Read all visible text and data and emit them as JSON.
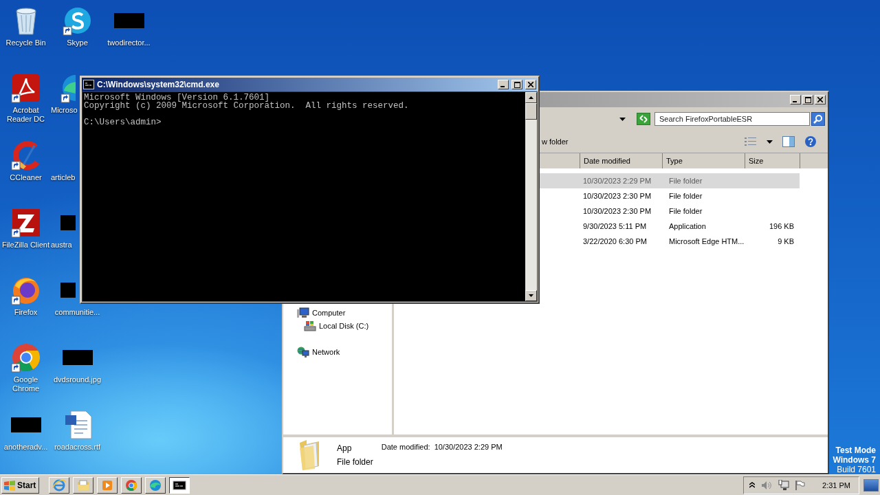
{
  "desktop_icons": [
    {
      "label": "Recycle Bin",
      "kind": "recycle",
      "shortcut": false
    },
    {
      "label": "Acrobat Reader DC",
      "kind": "acrobat",
      "shortcut": true
    },
    {
      "label": "CCleaner",
      "kind": "ccleaner",
      "shortcut": true
    },
    {
      "label": "FileZilla Client",
      "kind": "filezilla",
      "shortcut": true
    },
    {
      "label": "Firefox",
      "kind": "firefox",
      "shortcut": true
    },
    {
      "label": "Google Chrome",
      "kind": "chrome",
      "shortcut": true
    },
    {
      "label": "anotheradv...",
      "kind": "redacted",
      "shortcut": false
    },
    {
      "label": "Skype",
      "kind": "skype",
      "shortcut": true
    },
    {
      "label": "Microso",
      "kind": "edge",
      "shortcut": true
    },
    {
      "label": "articleb",
      "kind": "blank"
    },
    {
      "label": "austra",
      "kind": "redacted",
      "shortcut": false
    },
    {
      "label": "communitie...",
      "kind": "redacted",
      "shortcut": false
    },
    {
      "label": "dvdsround.jpg",
      "kind": "redacted",
      "shortcut": false
    },
    {
      "label": "roadacross.rtf",
      "kind": "word",
      "shortcut": false
    },
    {
      "label": "twodirector...",
      "kind": "redacted",
      "shortcut": false
    }
  ],
  "desktop_notice": [
    {
      "text": "Test Mode",
      "bold": true
    },
    {
      "text": "Windows 7",
      "bold": true
    },
    {
      "text": "Build 7601",
      "bold": false
    }
  ],
  "explorer": {
    "search": {
      "placeholder": "Search FirefoxPortableESR"
    },
    "toolbar_button": "w folder",
    "columns": [
      "Date modified",
      "Type",
      "Size"
    ],
    "rows": [
      {
        "date": "10/30/2023 2:29 PM",
        "type": "File folder",
        "selected": true
      },
      {
        "date": "10/30/2023 2:30 PM",
        "type": "File folder",
        "selected": false
      },
      {
        "date": "10/30/2023 2:30 PM",
        "type": "File folder",
        "selected": false
      },
      {
        "date": "9/30/2023 5:11 PM",
        "type": "Application",
        "size": "196 KB",
        "selected": false
      },
      {
        "date": "3/22/2020 6:30 PM",
        "type": "Microsoft Edge HTM...",
        "size": "9 KB",
        "selected": false
      }
    ],
    "nav": [
      {
        "label": "Computer",
        "kind": "computer",
        "children": [
          {
            "label": "Local Disk (C:)",
            "kind": "disk"
          }
        ]
      },
      {
        "label": "Network",
        "kind": "network"
      }
    ],
    "details": {
      "name": "App",
      "date_label": "Date modified:",
      "date": "10/30/2023 2:29 PM",
      "type": "File folder"
    }
  },
  "cmd": {
    "title": "C:\\Windows\\system32\\cmd.exe",
    "output": [
      "Microsoft Windows [Version 6.1.7601]",
      "Copyright (c) 2009 Microsoft Corporation.  All rights reserved."
    ],
    "prompt": "C:\\Users\\admin>"
  },
  "taskbar": {
    "start": "Start",
    "buttons": [
      {
        "kind": "ie",
        "selected": false
      },
      {
        "kind": "explorer",
        "selected": false
      },
      {
        "kind": "media",
        "selected": false
      },
      {
        "kind": "chrome",
        "selected": false
      },
      {
        "kind": "edge",
        "selected": false
      },
      {
        "kind": "cmd",
        "selected": true
      }
    ],
    "clock": "2:31 PM"
  }
}
